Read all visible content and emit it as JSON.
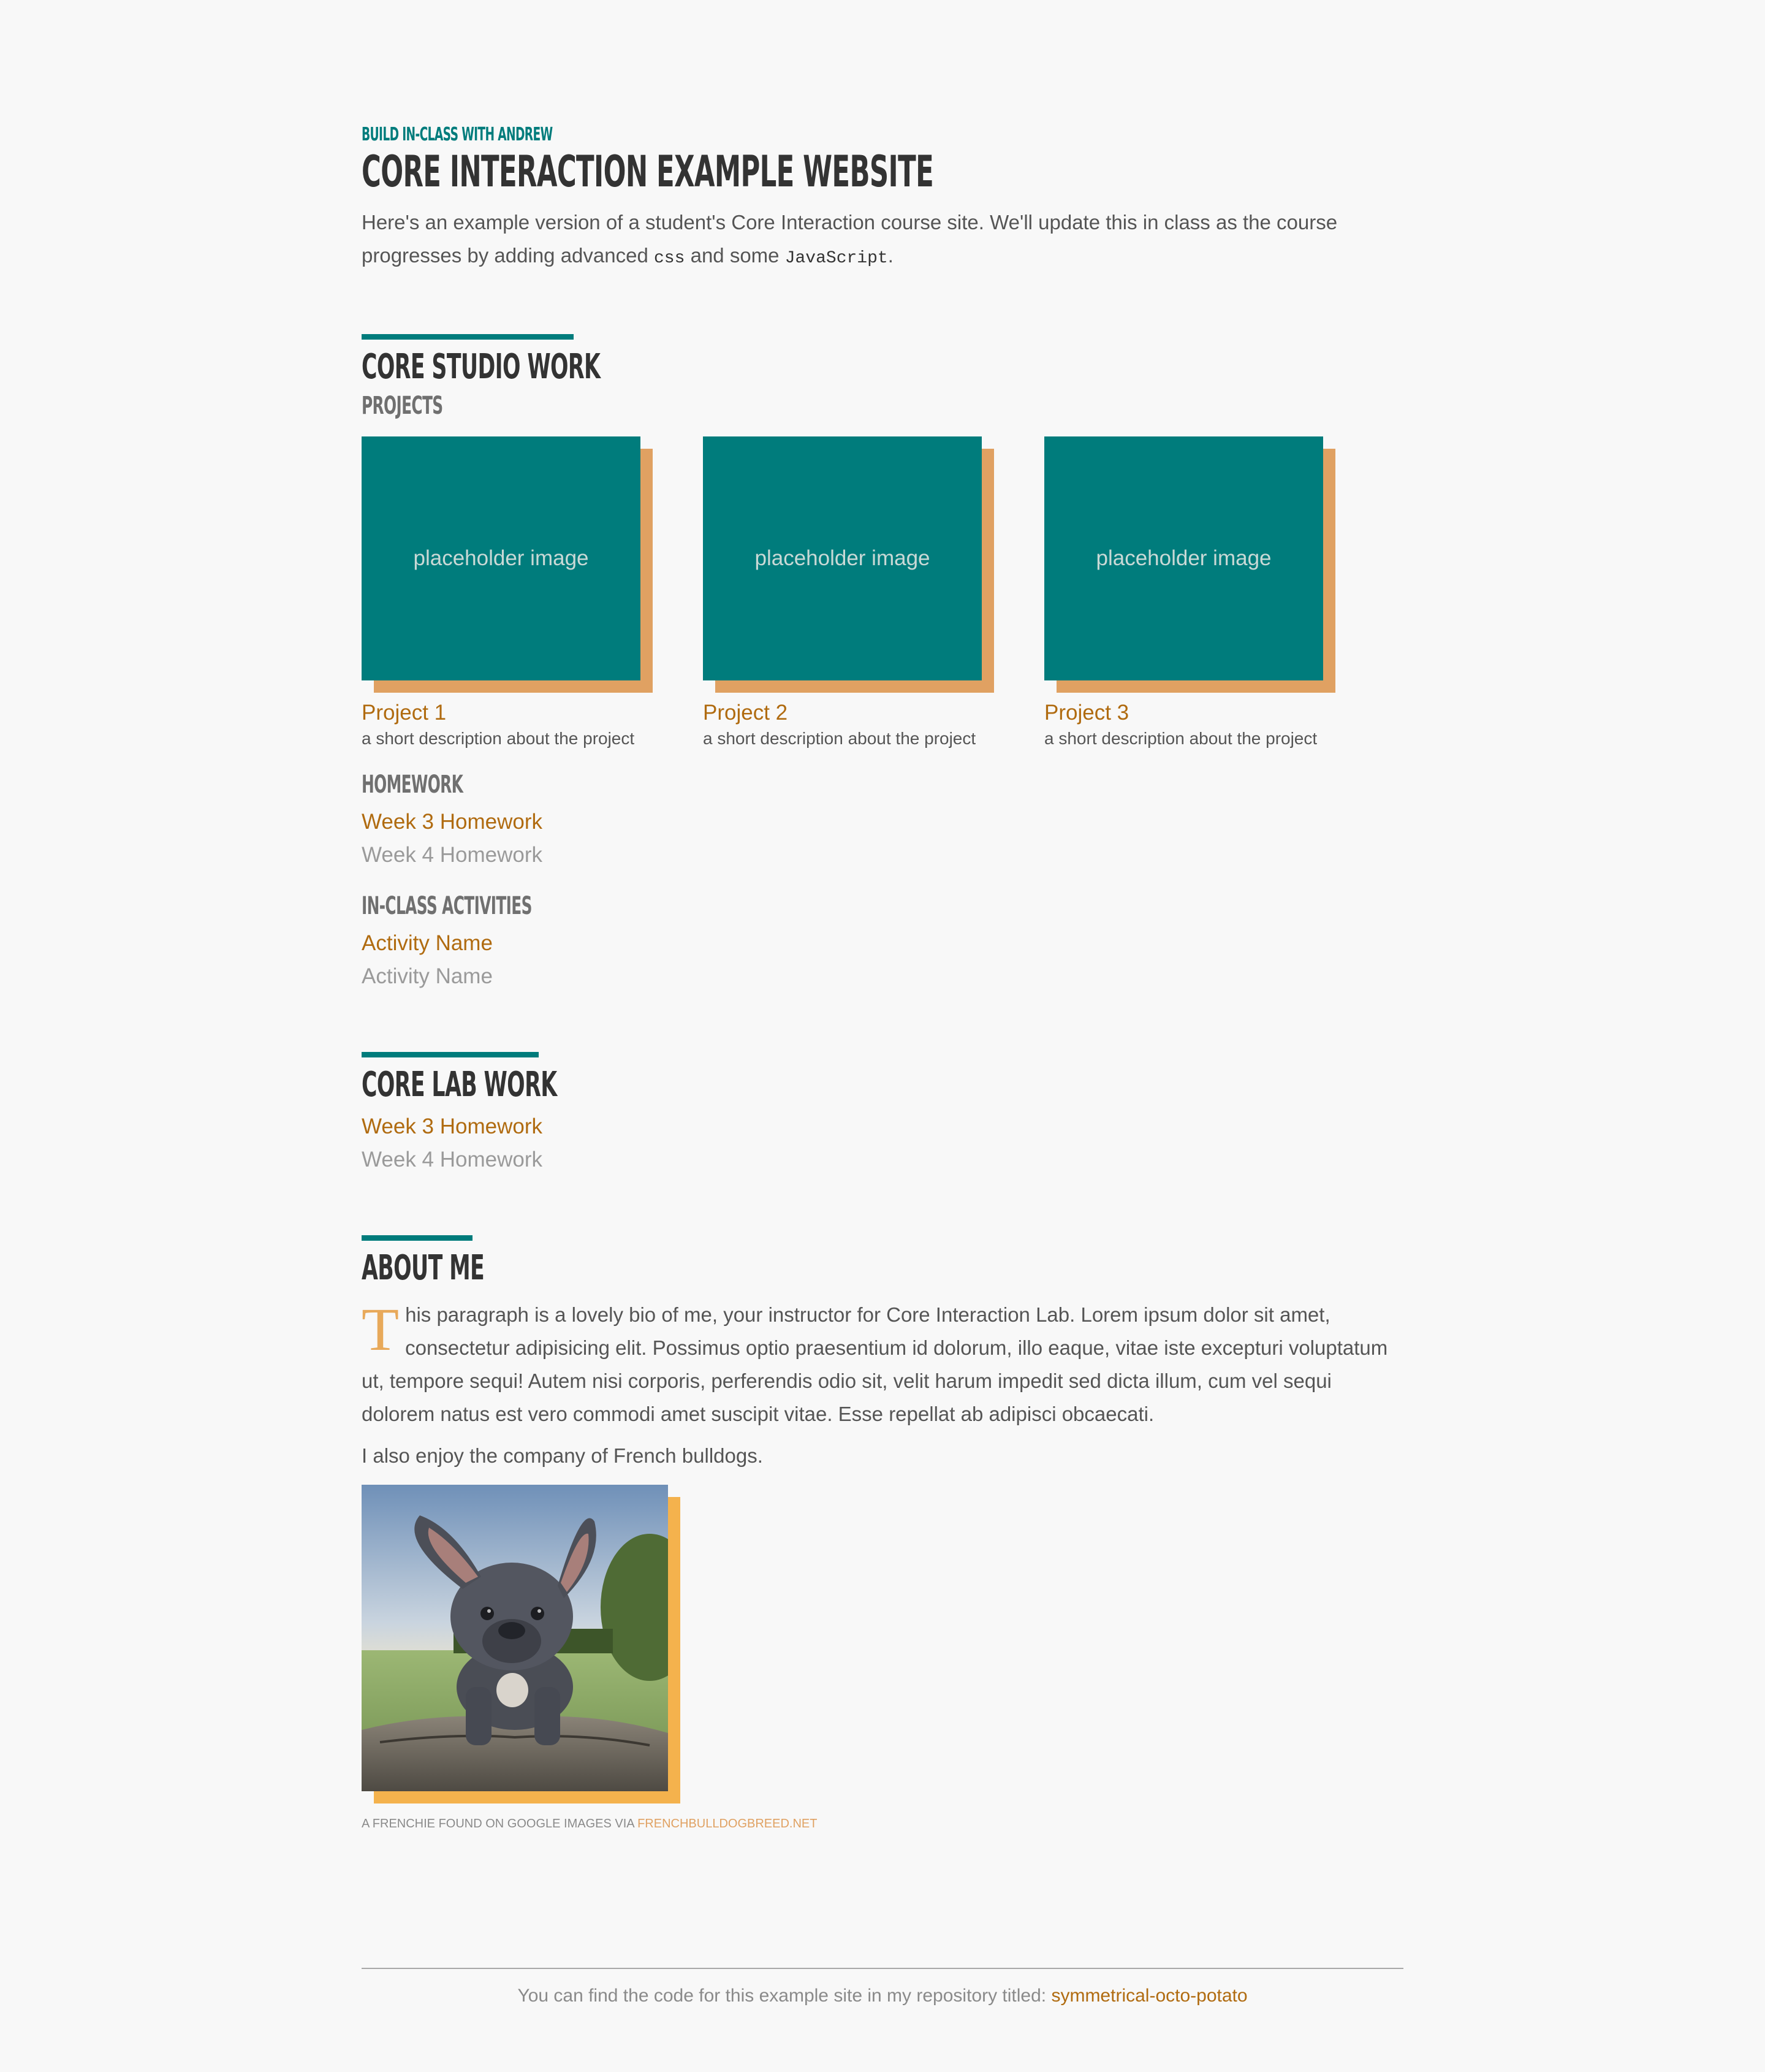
{
  "header": {
    "kicker": "BUILD IN-CLASS WITH ANDREW",
    "title": "CORE INTERACTION EXAMPLE WEBSITE",
    "intro_part1": "Here's an example version of a student's Core Interaction course site. We'll update this in class as the course progresses by adding advanced ",
    "intro_code1": "css",
    "intro_part2": " and some ",
    "intro_code2": "JavaScript",
    "intro_part3": "."
  },
  "studio": {
    "title": "CORE STUDIO WORK",
    "projects_heading": "PROJECTS",
    "projects": [
      {
        "image_label": "placeholder image",
        "title": "Project 1",
        "desc": "a short description about the project"
      },
      {
        "image_label": "placeholder image",
        "title": "Project 2",
        "desc": "a short description about the project"
      },
      {
        "image_label": "placeholder image",
        "title": "Project 3",
        "desc": "a short description about the project"
      }
    ],
    "homework_heading": "HOMEWORK",
    "homework": [
      "Week 3 Homework",
      "Week 4 Homework"
    ],
    "activities_heading": "IN-CLASS ACTIVITIES",
    "activities": [
      "Activity Name",
      "Activity Name"
    ]
  },
  "lab": {
    "title": "CORE LAB WORK",
    "items": [
      "Week 3 Homework",
      "Week 4 Homework"
    ]
  },
  "about": {
    "title": "ABOUT ME",
    "dropcap": "T",
    "bio_rest": "his paragraph is a lovely bio of me, your instructor for Core Interaction Lab. Lorem ipsum dolor sit amet, consectetur adipisicing elit. Possimus optio praesentium id dolorum, illo eaque, vitae iste excepturi voluptatum ut, tempore sequi! Autem nisi corporis, perferendis odio sit, velit harum impedit sed dicta illum, cum vel sequi dolorem natus est vero commodi amet suscipit vitae. Esse repellat ab adipisci obcaecati.",
    "bio_second": "I also enjoy the company of French bulldogs.",
    "caption_prefix": "A FRENCHIE FOUND ON GOOGLE IMAGES VIA ",
    "caption_link": "FRENCHBULLDOGBREED.NET"
  },
  "footer": {
    "text": "You can find the code for this example site in my repository titled: ",
    "link": "symmetrical-octo-potato"
  },
  "colors": {
    "teal": "#007c7c",
    "link_orange": "#b06b10",
    "shadow_orange": "#e0a162",
    "photo_shadow": "#f4b24d",
    "background": "#f8f8f8"
  }
}
